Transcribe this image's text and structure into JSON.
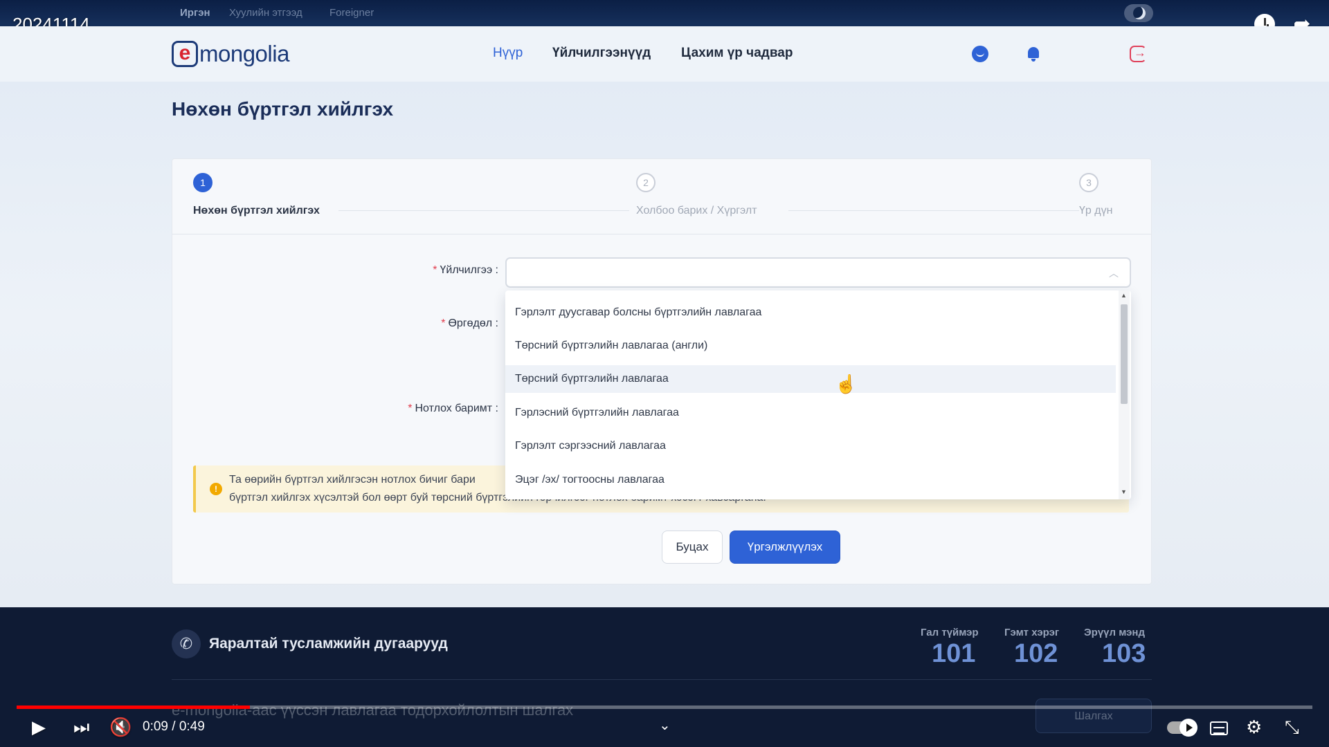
{
  "video": {
    "title": "20241114",
    "time": "0:09 / 0:49",
    "progress": 0.18
  },
  "topbar": {
    "languages": [
      "Иргэн",
      "Хуулийн этгээд",
      "Foreigner"
    ]
  },
  "header": {
    "logo_e": "e",
    "logo_text": "mongolia",
    "nav": [
      "Нүүр",
      "Үйлчилгээнүүд",
      "Цахим үр чадвар"
    ]
  },
  "page": {
    "title": "Нөхөн бүртгэл хийлгэх"
  },
  "steps": [
    {
      "num": "1",
      "label": "Нөхөн бүртгэл хийлгэх",
      "active": true
    },
    {
      "num": "2",
      "label": "Холбоо барих / Хүргэлт",
      "active": false
    },
    {
      "num": "3",
      "label": "Үр дүн",
      "active": false
    }
  ],
  "form": {
    "required_mark": "*",
    "service_label": "Үйлчилгээ :",
    "application_label": "Өргөдөл :",
    "proof_label": "Нотлох баримт :"
  },
  "dropdown": {
    "options": [
      "Гэрлэлт дуусгавар болсны бүртгэлийн лавлагаа",
      "Төрсний бүртгэлийн лавлагаа (англи)",
      "Төрсний бүртгэлийн лавлагаа",
      "Гэрлэсний бүртгэлийн лавлагаа",
      "Гэрлэлт сэргээсний лавлагаа",
      "Эцэг /эх/ тогтоосны лавлагаа"
    ],
    "hovered_index": 2
  },
  "alert": {
    "line1": "Та өөрийн бүртгэл хийлгэсэн нотлох бичиг бари",
    "line2": "бүртгэл хийлгэх хүсэлтэй бол өөрт буй төрсний бүртгэлийн гэрчилгээг нотлох баримт хэсэгт хавсаргана."
  },
  "buttons": {
    "back": "Буцах",
    "next": "Үргэлжлүүлэх"
  },
  "footer": {
    "emergency_title": "Яаралтай тусламжийн дугаарууд",
    "numbers": [
      {
        "label": "Гал түймэр",
        "value": "101"
      },
      {
        "label": "Гэмт хэрэг",
        "value": "102"
      },
      {
        "label": "Эрүүл мэнд",
        "value": "103"
      }
    ],
    "check_text": "e-mongolia-аас үүссэн лавлагаа тодорхойлолтын шалгах",
    "check_button": "Шалгах"
  },
  "colors": {
    "accent": "#2e62d6",
    "footer_bg": "#0f1b34",
    "required": "#e03b4b"
  }
}
